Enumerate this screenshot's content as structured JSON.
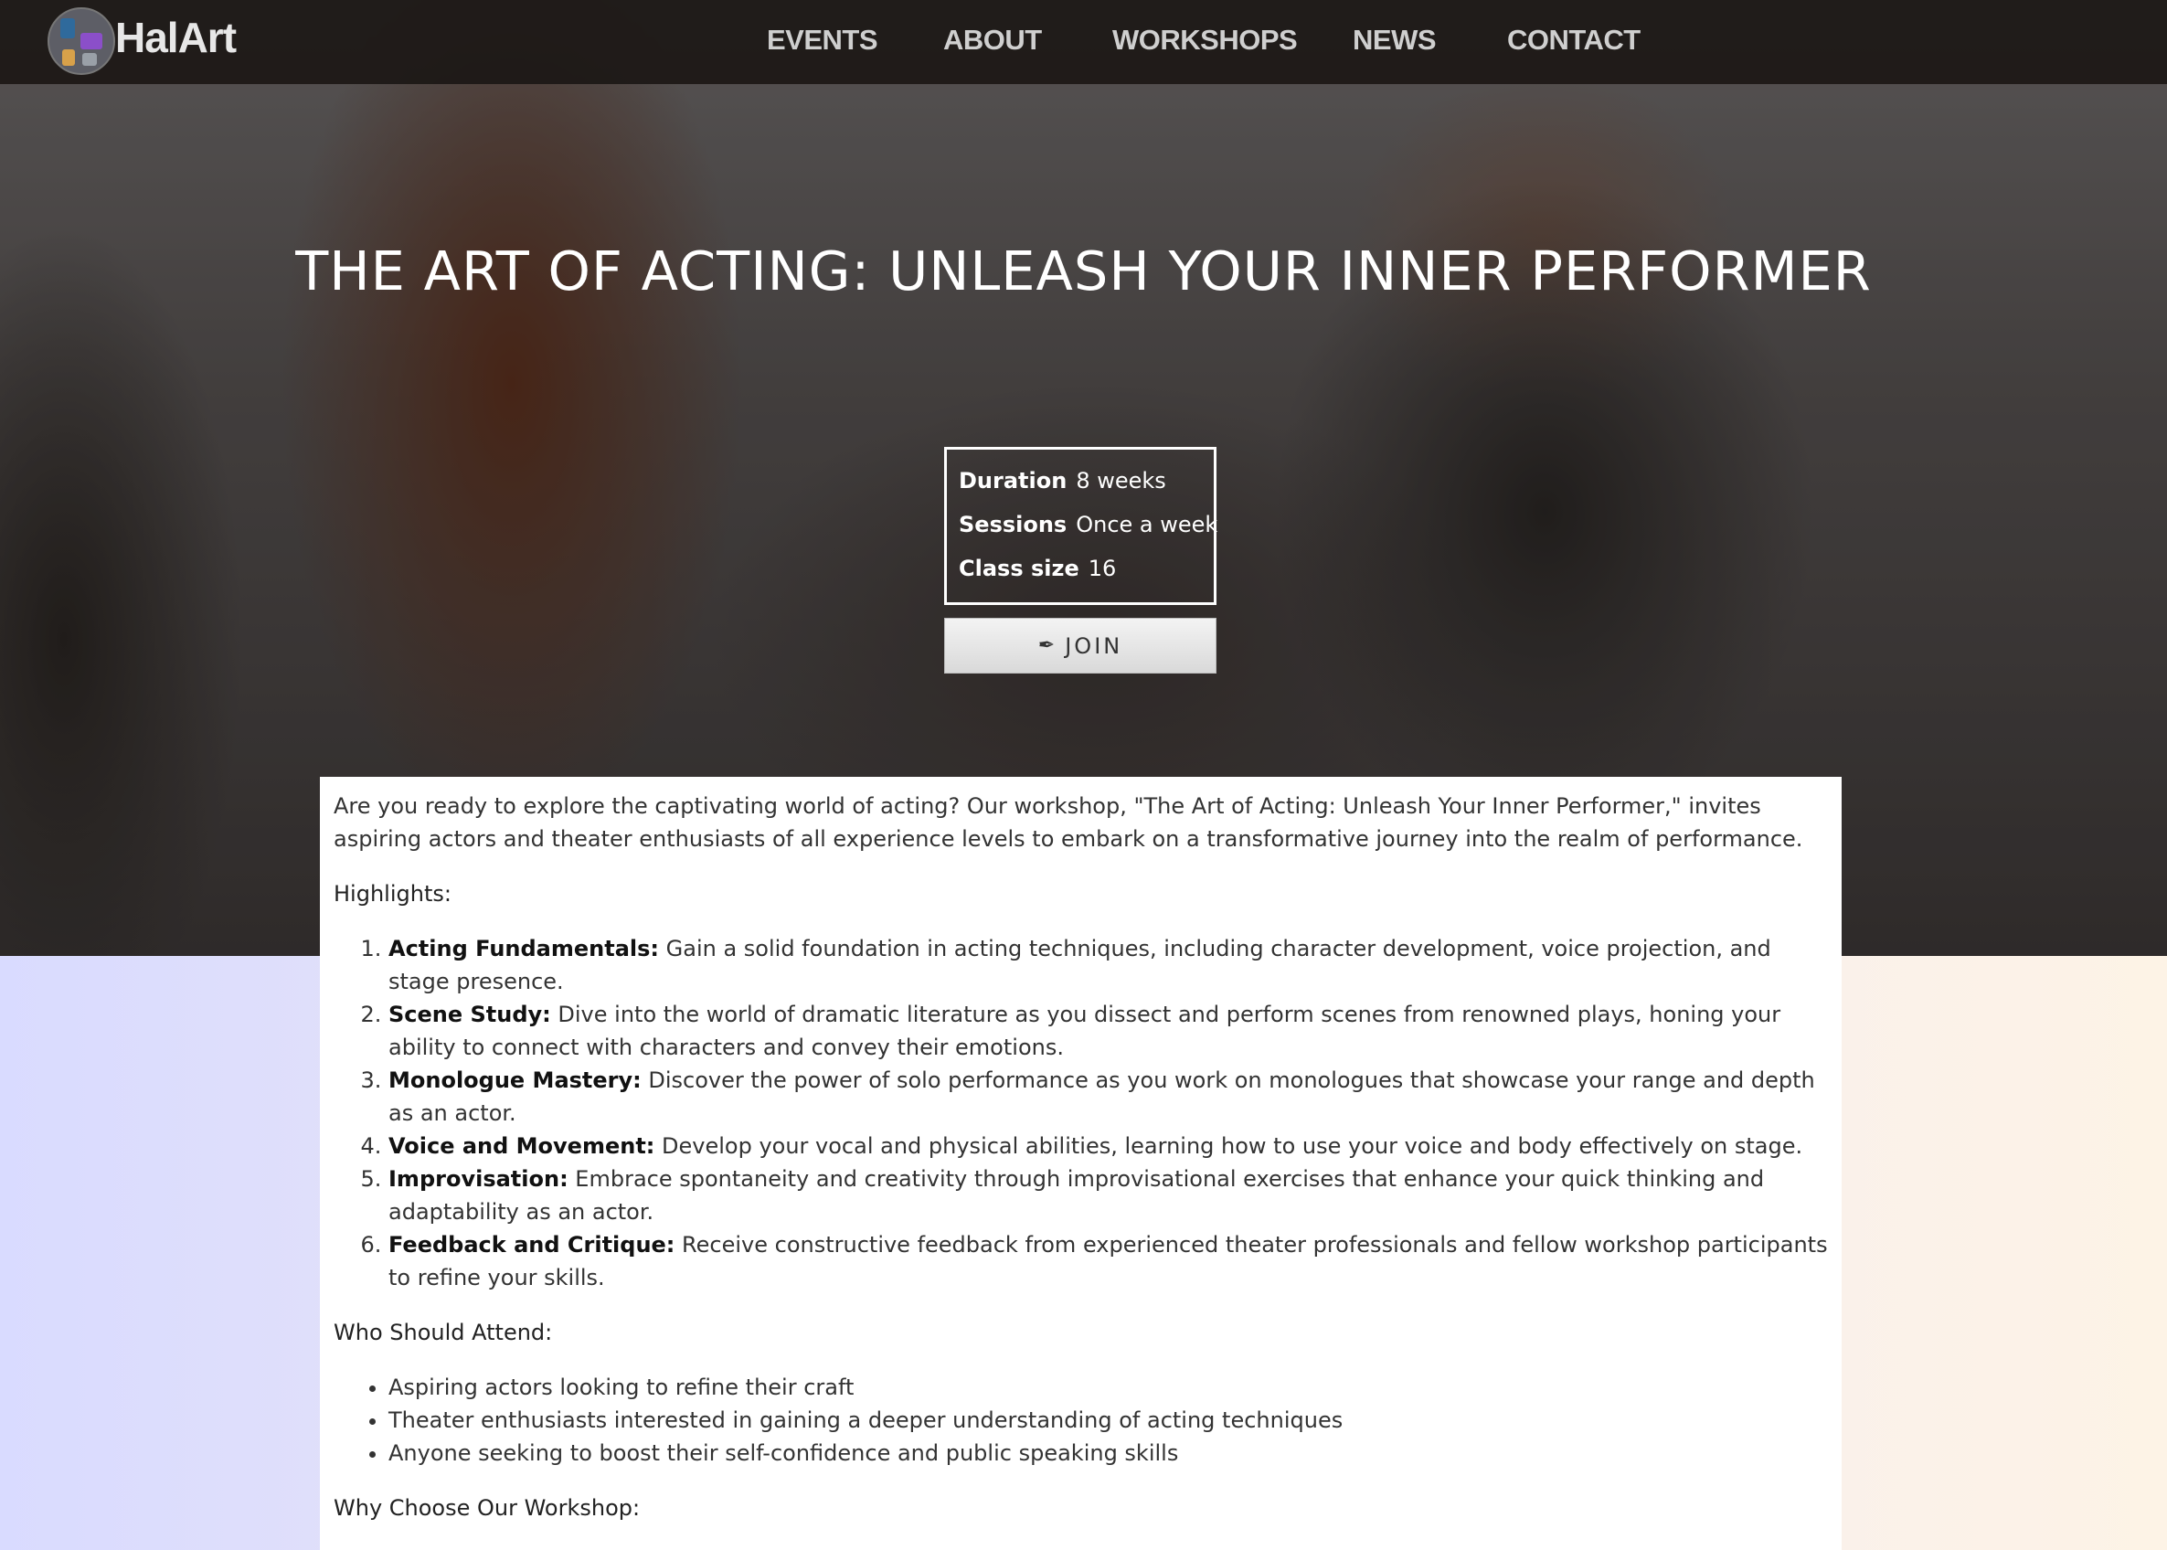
{
  "brand": {
    "name": "HalArt"
  },
  "nav": {
    "items": [
      {
        "label": "EVENTS"
      },
      {
        "label": "ABOUT"
      },
      {
        "label": "WORKSHOPS"
      },
      {
        "label": "NEWS"
      },
      {
        "label": "CONTACT"
      }
    ]
  },
  "hero": {
    "title": "THE ART OF ACTING: UNLEASH YOUR INNER PERFORMER",
    "details": [
      {
        "label": "Duration",
        "value": "8 weeks"
      },
      {
        "label": "Sessions",
        "value": "Once a week"
      },
      {
        "label": "Class size",
        "value": "16"
      }
    ],
    "join_label": "JOIN",
    "join_icon": "feather-icon"
  },
  "content": {
    "intro": "Are you ready to explore the captivating world of acting? Our workshop, \"The Art of Acting: Unleash Your Inner Performer,\" invites aspiring actors and theater enthusiasts of all experience levels to embark on a transformative journey into the realm of performance.",
    "highlights_heading": "Highlights:",
    "highlights": [
      {
        "title": "Acting Fundamentals:",
        "text": " Gain a solid foundation in acting techniques, including character development, voice projection, and stage presence."
      },
      {
        "title": "Scene Study:",
        "text": " Dive into the world of dramatic literature as you dissect and perform scenes from renowned plays, honing your ability to connect with characters and convey their emotions."
      },
      {
        "title": "Monologue Mastery:",
        "text": " Discover the power of solo performance as you work on monologues that showcase your range and depth as an actor."
      },
      {
        "title": "Voice and Movement:",
        "text": " Develop your vocal and physical abilities, learning how to use your voice and body effectively on stage."
      },
      {
        "title": "Improvisation:",
        "text": " Embrace spontaneity and creativity through improvisational exercises that enhance your quick thinking and adaptability as an actor."
      },
      {
        "title": "Feedback and Critique:",
        "text": " Receive constructive feedback from experienced theater professionals and fellow workshop participants to refine your skills."
      }
    ],
    "attend_heading": "Who Should Attend:",
    "attendees": [
      "Aspiring actors looking to refine their craft",
      "Theater enthusiasts interested in gaining a deeper understanding of acting techniques",
      "Anyone seeking to boost their self-confidence and public speaking skills"
    ],
    "why_heading": "Why Choose Our Workshop:"
  }
}
